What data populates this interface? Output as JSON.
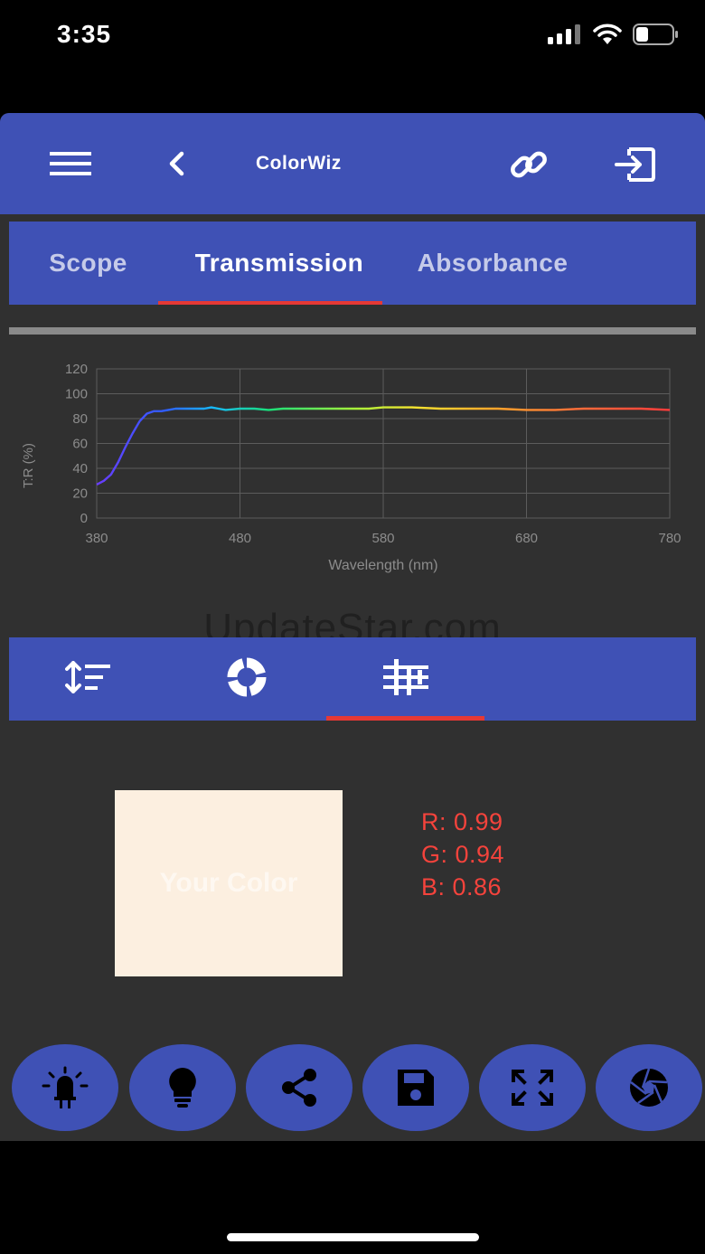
{
  "status": {
    "time": "3:35"
  },
  "appbar": {
    "title": "ColorWiz",
    "menu_icon": "hamburger-menu-icon",
    "back_icon": "chevron-left-icon",
    "link_icon": "link-icon",
    "exit_icon": "exit-to-app-icon"
  },
  "tabs": [
    {
      "label": "Scope",
      "active": false
    },
    {
      "label": "Transmission",
      "active": true
    },
    {
      "label": "Absorbance",
      "active": false
    }
  ],
  "chart_data": {
    "type": "line",
    "title": "",
    "xlabel": "Wavelength (nm)",
    "ylabel": "T:R (%)",
    "xlim": [
      380,
      780
    ],
    "ylim": [
      0,
      120
    ],
    "xticks": [
      380,
      480,
      580,
      680,
      780
    ],
    "yticks": [
      0,
      20,
      40,
      60,
      80,
      100,
      120
    ],
    "grid": true,
    "line_style": "spectrum-colored",
    "series": [
      {
        "x": [
          380,
          385,
          390,
          395,
          400,
          405,
          410,
          415,
          420,
          425,
          430,
          435,
          440,
          450,
          455,
          460,
          465,
          470,
          480,
          490,
          500,
          510,
          520,
          530,
          540,
          550,
          560,
          570,
          580,
          590,
          600,
          620,
          640,
          660,
          680,
          700,
          720,
          740,
          760,
          780
        ],
        "y": [
          27,
          30,
          35,
          45,
          57,
          68,
          78,
          84,
          86,
          86,
          87,
          88,
          88,
          88,
          88,
          89,
          88,
          87,
          88,
          88,
          87,
          88,
          88,
          88,
          88,
          88,
          88,
          88,
          89,
          89,
          89,
          88,
          88,
          88,
          87,
          87,
          88,
          88,
          88,
          87
        ]
      }
    ]
  },
  "watermark": "UpdateStar.com",
  "subtabs": [
    {
      "icon": "sort-lines-icon",
      "active": false
    },
    {
      "icon": "color-wheel-icon",
      "active": false
    },
    {
      "icon": "tune-sliders-icon",
      "active": true
    }
  ],
  "color": {
    "label": "Your Color",
    "swatch": "#fcefe0",
    "r_text": "R: 0.99",
    "g_text": "G: 0.94",
    "b_text": "B: 0.86"
  },
  "actions": [
    {
      "icon": "led-light-icon"
    },
    {
      "icon": "lightbulb-icon"
    },
    {
      "icon": "share-icon"
    },
    {
      "icon": "save-icon"
    },
    {
      "icon": "expand-arrows-icon"
    },
    {
      "icon": "camera-shutter-icon"
    }
  ],
  "colors": {
    "primary": "#3f51b5",
    "accent": "#e53935",
    "background": "#303030",
    "rgb_text": "#f4433c"
  }
}
